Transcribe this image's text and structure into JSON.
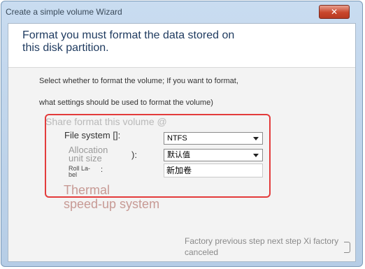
{
  "window": {
    "title": "Create a simple volume Wizard",
    "close_label": "✕"
  },
  "header": {
    "heading": "Format you must format the data stored on this disk partition."
  },
  "instructions": {
    "line1": "Select whether to format the volume; If you want to format,",
    "line2": "what settings should be used to format the volume)"
  },
  "format_group": {
    "label": "Share format this volume @",
    "file_system": {
      "label": "File system []:",
      "value": "NTFS"
    },
    "allocation_unit_size": {
      "label_line1": "Allocation",
      "label_line2": "unit size",
      "suffix": "):",
      "value": "默认值"
    },
    "volume_label": {
      "label_line1": "Roll La-",
      "label_line2": "bel",
      "colon": ":",
      "value": "新加卷"
    }
  },
  "overlay_text": {
    "line1": "Thermal",
    "line2": "speed-up system"
  },
  "footer": {
    "buttons_text": "Factory previous step next step Xi factory canceled"
  },
  "colors": {
    "highlight": "#e33b3b",
    "heading": "#1e3a5f",
    "close_button": "#c9472c"
  },
  "icons": {
    "close": "close-icon",
    "dropdown": "chevron-down-icon"
  }
}
